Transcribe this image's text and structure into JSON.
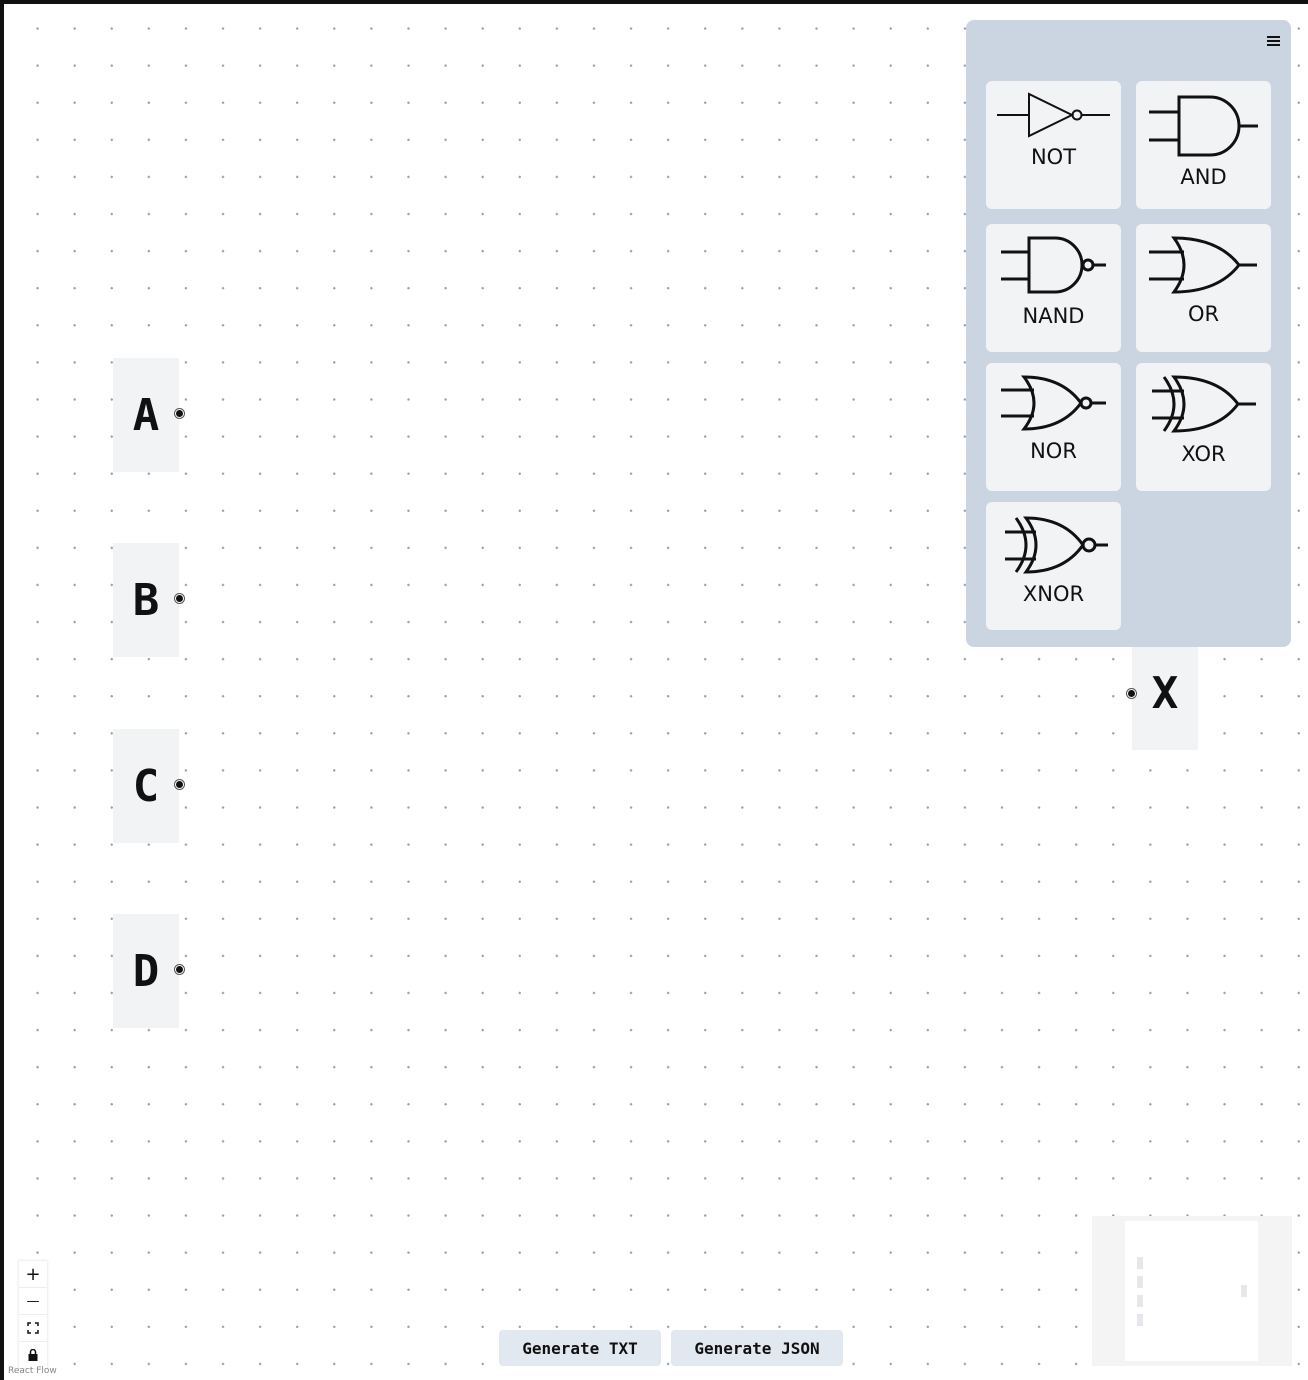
{
  "canvas": {
    "input_nodes": [
      "A",
      "B",
      "C",
      "D"
    ],
    "output_nodes": [
      "X"
    ]
  },
  "palette": {
    "menu_icon": "hamburger-menu-icon",
    "gates": [
      {
        "label": "NOT",
        "icon": "not-gate-icon"
      },
      {
        "label": "AND",
        "icon": "and-gate-icon"
      },
      {
        "label": "NAND",
        "icon": "nand-gate-icon"
      },
      {
        "label": "OR",
        "icon": "or-gate-icon"
      },
      {
        "label": "NOR",
        "icon": "nor-gate-icon"
      },
      {
        "label": "XOR",
        "icon": "xor-gate-icon"
      },
      {
        "label": "XNOR",
        "icon": "xnor-gate-icon"
      }
    ],
    "background_color": "#cbd5e1",
    "card_color": "#f2f3f5"
  },
  "controls": {
    "zoom_in": "+",
    "zoom_out": "—",
    "fit_view_icon": "fit-view-icon",
    "lock_icon": "lock-icon"
  },
  "actions": {
    "generate_txt": "Generate TXT",
    "generate_json": "Generate JSON"
  },
  "attribution": "React Flow"
}
